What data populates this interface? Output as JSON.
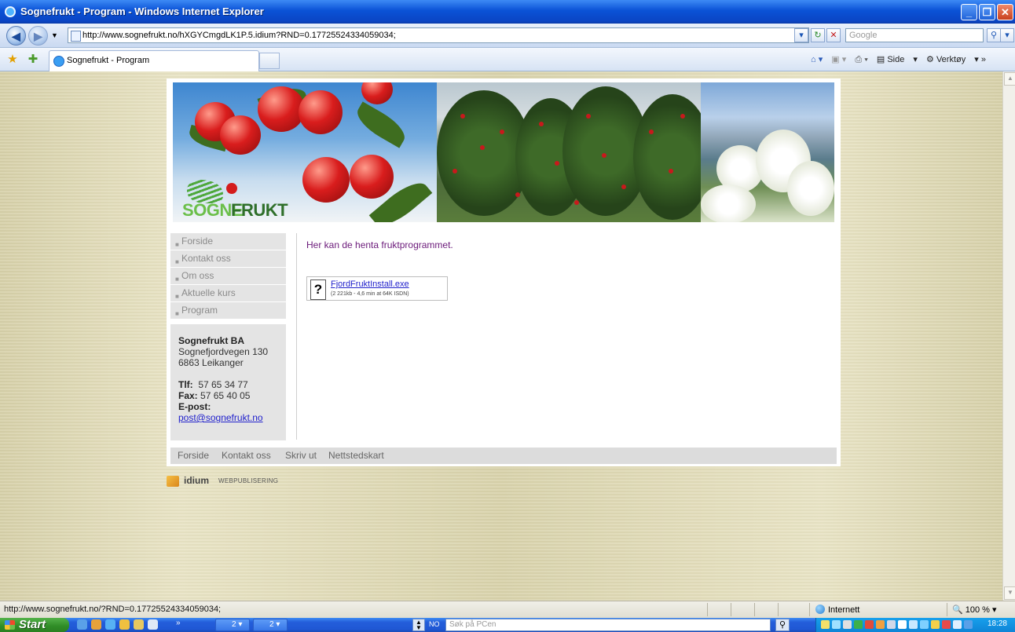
{
  "window": {
    "title": "Sognefrukt - Program - Windows Internet Explorer"
  },
  "address_bar": {
    "url": "http://www.sognefrukt.no/hXGYCmgdLK1P.5.idium?RND=0.17725524334059034;",
    "search_placeholder": "Google"
  },
  "tab": {
    "label": "Sognefrukt - Program"
  },
  "command_bar": {
    "side": "Side",
    "verktoy": "Verktøy"
  },
  "logo": {
    "part1": "SOGNE",
    "part2": "FRUKT"
  },
  "nav": [
    {
      "label": "Forside"
    },
    {
      "label": "Kontakt oss"
    },
    {
      "label": "Om oss"
    },
    {
      "label": "Aktuelle kurs"
    },
    {
      "label": "Program"
    }
  ],
  "contact": {
    "company": "Sognefrukt BA",
    "address1": "Sognefjordvegen 130",
    "address2": "6863 Leikanger",
    "tlf_label": "Tlf:",
    "tlf": "57 65 34 77",
    "fax_label": "Fax:",
    "fax": "57 65 40 05",
    "email_label": "E-post:",
    "email": "post@sognefrukt.no"
  },
  "main": {
    "intro": "Her kan de henta fruktprogrammet.",
    "file": {
      "name": "FjordFruktInstall.exe",
      "meta": "(2 221kb - 4,6 min at 64K ISDN)"
    }
  },
  "footer": [
    "Forside",
    "Kontakt oss",
    "Skriv ut",
    "Nettstedskart"
  ],
  "idium": {
    "name": "idium",
    "sub": "WEBPUBLISERING"
  },
  "status_bar": {
    "url": "http://www.sognefrukt.no/?RND=0.17725524334059034;",
    "zone": "Internett",
    "zoom": "100 %"
  },
  "taskbar": {
    "start": "Start",
    "btn1": "2",
    "btn2": "2",
    "lang": "NO",
    "search_placeholder": "Søk på PCen",
    "clock": "18:28"
  }
}
